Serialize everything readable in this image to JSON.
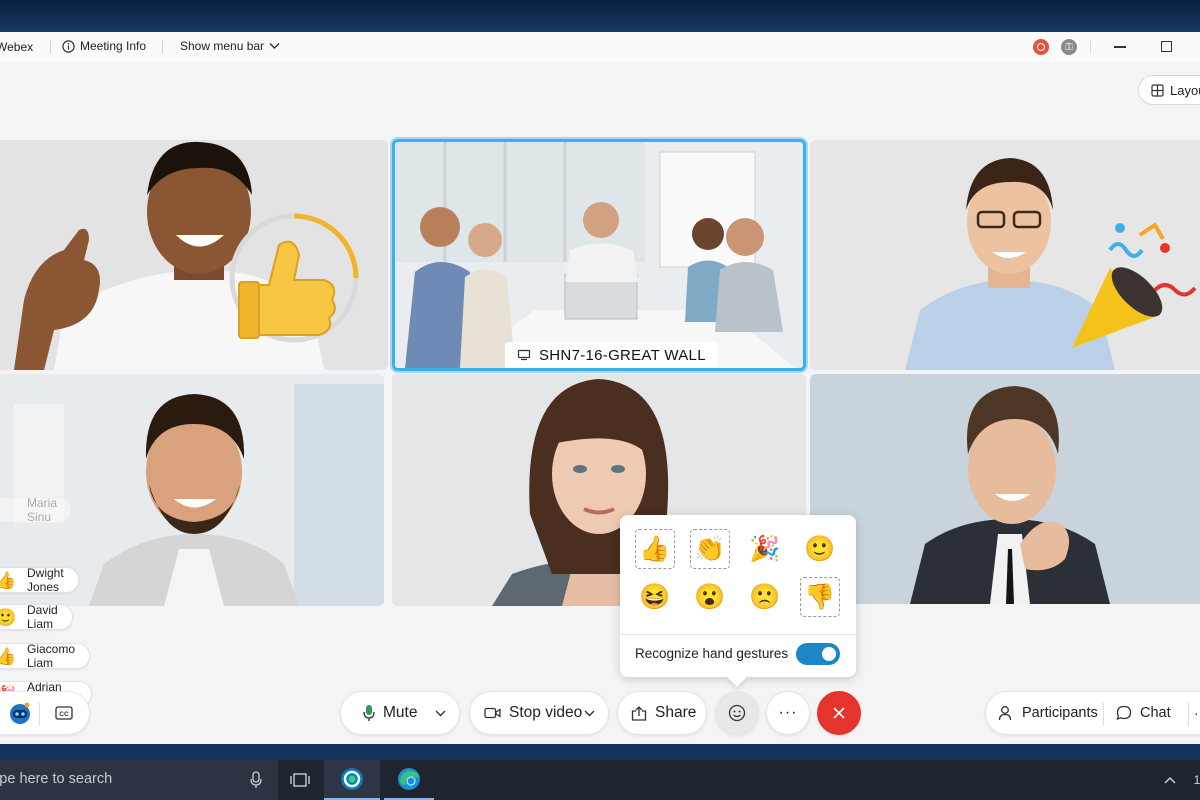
{
  "titlebar": {
    "app_name": "Webex",
    "meeting_info": "Meeting Info",
    "show_menu_bar": "Show menu bar"
  },
  "layout_button": {
    "label": "Layout"
  },
  "video_grid": {
    "active_room_label": "SHN7-16-GREAT WALL"
  },
  "participant_reactions": [
    {
      "name": "Maria Sinu",
      "emoji": "",
      "faded": true
    },
    {
      "name": "Dwight Jones",
      "emoji": "👍",
      "faded": false
    },
    {
      "name": "David Liam",
      "emoji": "🙂",
      "faded": false
    },
    {
      "name": "Giacomo Liam",
      "emoji": "👍",
      "faded": false
    },
    {
      "name": "Adrian Delamico",
      "emoji": "🎉",
      "faded": false
    }
  ],
  "reactions_panel": {
    "emojis": [
      {
        "name": "thumbs-up",
        "glyph": "👍"
      },
      {
        "name": "clap",
        "glyph": "👏"
      },
      {
        "name": "celebrate",
        "glyph": "🎉"
      },
      {
        "name": "smile",
        "glyph": "🙂"
      },
      {
        "name": "laugh",
        "glyph": "😆"
      },
      {
        "name": "surprised",
        "glyph": "😮"
      },
      {
        "name": "sad",
        "glyph": "🙁"
      },
      {
        "name": "thumbs-down",
        "glyph": "👎"
      }
    ],
    "gesture_label": "Recognize hand gestures",
    "gesture_enabled": true
  },
  "controls": {
    "mute": "Mute",
    "stop_video": "Stop video",
    "share": "Share",
    "more": "···",
    "participants": "Participants",
    "chat": "Chat"
  },
  "taskbar": {
    "search_placeholder": "Type here to search",
    "clock_partial": "1"
  },
  "colors": {
    "accent_blue": "#1c86c7",
    "active_tile_border": "#3ab1ea",
    "end_call_red": "#e5342b",
    "mic_green": "#2d9a4e"
  }
}
